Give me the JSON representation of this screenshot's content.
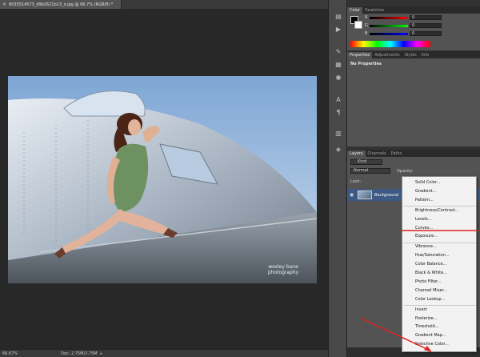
{
  "document": {
    "tab_title": "8035514573_d9b2621b13_o.jpg @ 66.7% (RGB/8) *",
    "close_glyph": "×"
  },
  "status": {
    "zoom": "66.67%",
    "doc_info": "Doc: 2.75M/2.75M",
    "arrow": "▸"
  },
  "watermark": {
    "line1": "wesley bane",
    "line2": "photography"
  },
  "color_panel": {
    "tabs": [
      "Color",
      "Swatches"
    ],
    "channels": [
      {
        "label": "R",
        "value": "0",
        "color": "#d02020"
      },
      {
        "label": "G",
        "value": "0",
        "color": "#20b020"
      },
      {
        "label": "B",
        "value": "0",
        "color": "#2040d0"
      }
    ]
  },
  "properties_panel": {
    "tabs": [
      "Properties",
      "Adjustments",
      "Styles",
      "Info"
    ],
    "message": "No Properties"
  },
  "layers_panel": {
    "tabs": [
      "Layers",
      "Channels",
      "Paths"
    ],
    "filter_label": "Kind",
    "blend_mode": "Normal",
    "opacity_label": "Opacity:",
    "lock_label": "Lock:",
    "layer_name": "Background"
  },
  "adjustment_menu": {
    "groups": [
      [
        "Solid Color...",
        "Gradient...",
        "Pattern..."
      ],
      [
        "Brightness/Contrast...",
        "Levels...",
        "Curves...",
        "Exposure..."
      ],
      [
        "Vibrance...",
        "Hue/Saturation...",
        "Color Balance...",
        "Black & White...",
        "Photo Filter...",
        "Channel Mixer...",
        "Color Lookup..."
      ],
      [
        "Invert",
        "Posterize...",
        "Threshold...",
        "Gradient Map...",
        "Selective Color..."
      ]
    ]
  },
  "accent": {
    "annotation_red": "#e0221f",
    "layer_selected": "#3d5a84"
  }
}
